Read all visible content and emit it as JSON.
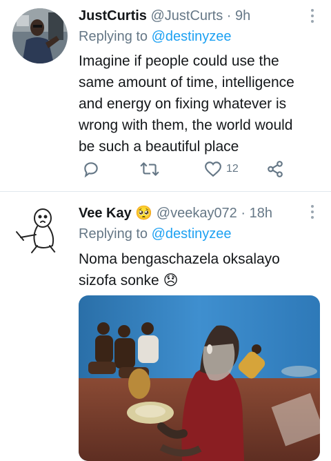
{
  "tweets": [
    {
      "name": "JustCurtis",
      "handle": "@JustCurts",
      "separator": "·",
      "time": "9h",
      "replying_prefix": "Replying to",
      "replying_to": "@destinyzee",
      "text_lines": [
        "Imagine if people could use  the",
        "same amount of time, intelligence",
        "and energy on fixing whatever is",
        "wrong with them, the world would",
        "be such a beautiful place"
      ],
      "like_count": "12"
    },
    {
      "name": "Vee Kay",
      "name_emoji": "🥺",
      "handle": "@veekay072",
      "separator": "·",
      "time": "18h",
      "replying_prefix": "Replying to",
      "replying_to": "@destinyzee",
      "text_lines": [
        "Noma bengaschazela oksalayo",
        "sizofa sonke"
      ],
      "text_emoji": "😞"
    }
  ],
  "colors": {
    "link": "#1da1f2",
    "muted": "#657786",
    "divider": "#e1e8ed"
  },
  "icons": [
    "reply-icon",
    "retweet-icon",
    "like-icon",
    "share-icon",
    "more-options-icon"
  ]
}
